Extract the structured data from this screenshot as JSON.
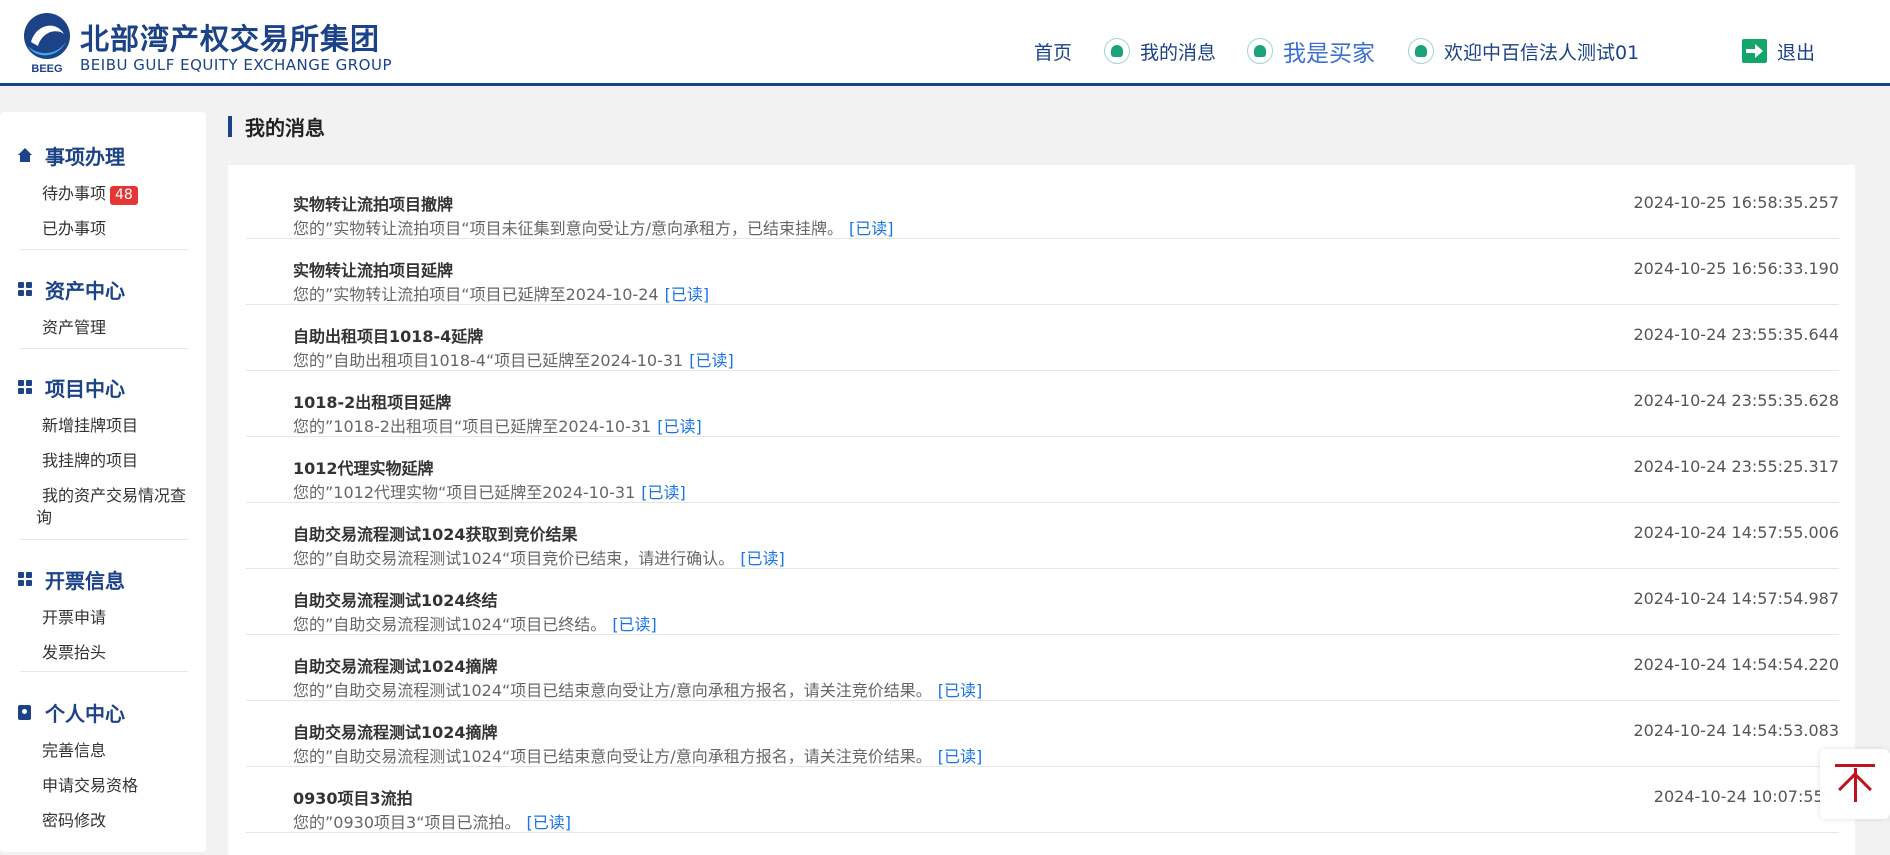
{
  "header": {
    "logo_cn": "北部湾产权交易所集团",
    "logo_en": "BEIBU GULF EQUITY EXCHANGE GROUP",
    "logo_abbr": "BEEG",
    "nav": {
      "home": "首页",
      "messages": "我的消息",
      "buyer": "我是买家",
      "welcome": "欢迎中百信法人测试01",
      "logout": "退出"
    }
  },
  "sidebar": {
    "sections": [
      {
        "title": "事项办理",
        "icon": "home-icon",
        "items": [
          "待办事项",
          "已办事项"
        ],
        "badge": "48"
      },
      {
        "title": "资产中心",
        "icon": "grid-icon",
        "items": [
          "资产管理"
        ]
      },
      {
        "title": "项目中心",
        "icon": "grid-icon",
        "items": [
          "新增挂牌项目",
          "我挂牌的项目",
          "我的资产交易情况查询"
        ]
      },
      {
        "title": "开票信息",
        "icon": "grid-icon",
        "items": [
          "开票申请",
          "发票抬头"
        ]
      },
      {
        "title": "个人中心",
        "icon": "user-card-icon",
        "items": [
          "完善信息",
          "申请交易资格",
          "密码修改"
        ]
      }
    ]
  },
  "main": {
    "title": "我的消息",
    "read_label": "[已读]",
    "messages": [
      {
        "title": "实物转让流拍项目撤牌",
        "body": "您的”实物转让流拍项目“项目未征集到意向受让方/意向承租方，已结束挂牌。",
        "time": "2024-10-25 16:58:35.257"
      },
      {
        "title": "实物转让流拍项目延牌",
        "body": "您的”实物转让流拍项目“项目已延牌至2024-10-24",
        "time": "2024-10-25 16:56:33.190"
      },
      {
        "title": "自助出租项目1018-4延牌",
        "body": "您的”自助出租项目1018-4“项目已延牌至2024-10-31",
        "time": "2024-10-24 23:55:35.644"
      },
      {
        "title": "1018-2出租项目延牌",
        "body": "您的”1018-2出租项目“项目已延牌至2024-10-31",
        "time": "2024-10-24 23:55:35.628"
      },
      {
        "title": "1012代理实物延牌",
        "body": "您的”1012代理实物“项目已延牌至2024-10-31",
        "time": "2024-10-24 23:55:25.317"
      },
      {
        "title": "自助交易流程测试1024获取到竞价结果",
        "body": "您的”自助交易流程测试1024“项目竞价已结束，请进行确认。",
        "time": "2024-10-24 14:57:55.006"
      },
      {
        "title": "自助交易流程测试1024终结",
        "body": "您的”自助交易流程测试1024“项目已终结。",
        "time": "2024-10-24 14:57:54.987"
      },
      {
        "title": "自助交易流程测试1024摘牌",
        "body": "您的”自助交易流程测试1024“项目已结束意向受让方/意向承租方报名，请关注竞价结果。",
        "time": "2024-10-24 14:54:54.220"
      },
      {
        "title": "自助交易流程测试1024摘牌",
        "body": "您的”自助交易流程测试1024“项目已结束意向受让方/意向承租方报名，请关注竞价结果。",
        "time": "2024-10-24 14:54:53.083"
      },
      {
        "title": "0930项目3流拍",
        "body": "您的”0930项目3“项目已流拍。",
        "time": "2024-10-24 10:07:55.6"
      }
    ]
  },
  "colors": {
    "brand": "#1c4287",
    "accent_green": "#1aa37a",
    "link": "#1a73e8",
    "badge": "#e53535",
    "to_top": "#c1121f"
  }
}
